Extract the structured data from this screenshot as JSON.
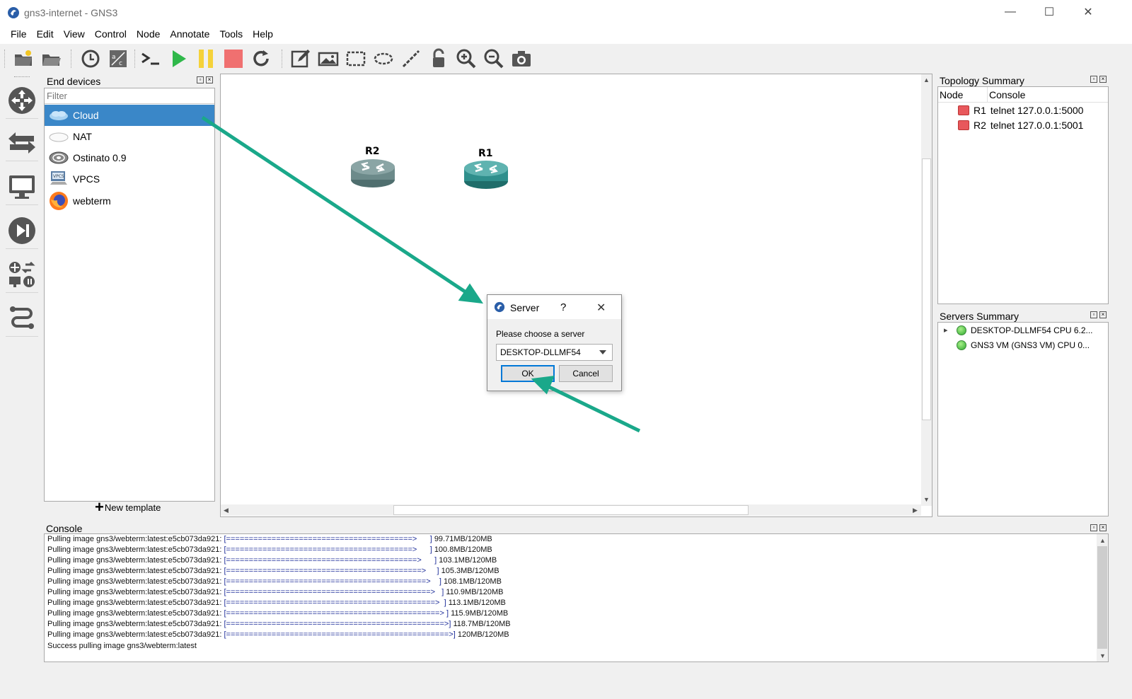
{
  "window": {
    "title": "gns3-internet - GNS3",
    "minimize_glyph": "—",
    "maximize_glyph": "☐",
    "close_glyph": "✕"
  },
  "menu": [
    "File",
    "Edit",
    "View",
    "Control",
    "Node",
    "Annotate",
    "Tools",
    "Help"
  ],
  "toolbar": {
    "icons": [
      "new-project-icon",
      "open-project-icon",
      "snapshot-icon",
      "show-interface-labels-icon",
      "console-all-icon",
      "start-all-icon",
      "suspend-all-icon",
      "stop-all-icon",
      "reload-all-icon",
      "add-note-icon",
      "insert-picture-icon",
      "draw-rectangle-icon",
      "draw-ellipse-icon",
      "draw-line-icon",
      "lock-icon",
      "zoom-in-icon",
      "zoom-out-icon",
      "screenshot-icon"
    ],
    "terminal_glyph": ">_"
  },
  "device_types": [
    "routers-icon",
    "switches-icon",
    "end-devices-icon",
    "security-devices-icon",
    "all-devices-icon",
    "add-link-icon"
  ],
  "end_devices_panel": {
    "title": "End devices",
    "filter_placeholder": "Filter",
    "items": [
      {
        "label": "Cloud",
        "icon": "cloud-icon",
        "selected": true
      },
      {
        "label": "NAT",
        "icon": "nat-cloud-icon",
        "selected": false
      },
      {
        "label": "Ostinato 0.9",
        "icon": "ostinato-icon",
        "selected": false
      },
      {
        "label": "VPCS",
        "icon": "vpcs-icon",
        "selected": false
      },
      {
        "label": "webterm",
        "icon": "firefox-icon",
        "selected": false
      }
    ],
    "new_template_label": "New template"
  },
  "canvas": {
    "nodes": [
      {
        "label": "R2",
        "icon": "router-icon",
        "status": "stopped"
      },
      {
        "label": "R1",
        "icon": "router-icon",
        "status": "stopped"
      }
    ]
  },
  "topology_summary": {
    "title": "Topology Summary",
    "columns": [
      "Node",
      "Console"
    ],
    "rows": [
      {
        "node": "R1",
        "console": "telnet 127.0.0.1:5000"
      },
      {
        "node": "R2",
        "console": "telnet 127.0.0.1:5001"
      }
    ]
  },
  "servers_summary": {
    "title": "Servers Summary",
    "rows": [
      {
        "label": "DESKTOP-DLLMF54 CPU 6.2...",
        "expand": "▸"
      },
      {
        "label": "GNS3 VM (GNS3 VM) CPU 0..."
      }
    ]
  },
  "console": {
    "title": "Console",
    "lines": [
      {
        "prefix": "Pulling image gns3/webterm:latest:e5cb073da921: ",
        "bar": "[=========================================>      ]",
        "size": "99.71MB/120MB"
      },
      {
        "prefix": "Pulling image gns3/webterm:latest:e5cb073da921: ",
        "bar": "[=========================================>      ]",
        "size": "100.8MB/120MB"
      },
      {
        "prefix": "Pulling image gns3/webterm:latest:e5cb073da921: ",
        "bar": "[==========================================>      ]",
        "size": "103.1MB/120MB"
      },
      {
        "prefix": "Pulling image gns3/webterm:latest:e5cb073da921: ",
        "bar": "[===========================================>     ]",
        "size": "105.3MB/120MB"
      },
      {
        "prefix": "Pulling image gns3/webterm:latest:e5cb073da921: ",
        "bar": "[============================================>    ]",
        "size": "108.1MB/120MB"
      },
      {
        "prefix": "Pulling image gns3/webterm:latest:e5cb073da921: ",
        "bar": "[=============================================>   ]",
        "size": "110.9MB/120MB"
      },
      {
        "prefix": "Pulling image gns3/webterm:latest:e5cb073da921: ",
        "bar": "[==============================================>  ]",
        "size": "113.1MB/120MB"
      },
      {
        "prefix": "Pulling image gns3/webterm:latest:e5cb073da921: ",
        "bar": "[===============================================> ]",
        "size": "115.9MB/120MB"
      },
      {
        "prefix": "Pulling image gns3/webterm:latest:e5cb073da921: ",
        "bar": "[================================================>]",
        "size": "118.7MB/120MB"
      },
      {
        "prefix": "Pulling image gns3/webterm:latest:e5cb073da921: ",
        "bar": "[=================================================>]",
        "size": "120MB/120MB"
      }
    ],
    "final_line": "Success pulling image gns3/webterm:latest"
  },
  "dialog": {
    "title": "Server",
    "help_glyph": "?",
    "close_glyph": "✕",
    "prompt": "Please choose a server",
    "selected_server": "DESKTOP-DLLMF54",
    "ok_label": "OK",
    "cancel_label": "Cancel"
  },
  "colors": {
    "selection": "#3a87c8",
    "annotation_arrow": "#1aa88a",
    "start_green": "#2fb84a",
    "suspend_yellow": "#f5d23a",
    "stop_red": "#f07070",
    "router_teal": "#2f8f8c"
  }
}
